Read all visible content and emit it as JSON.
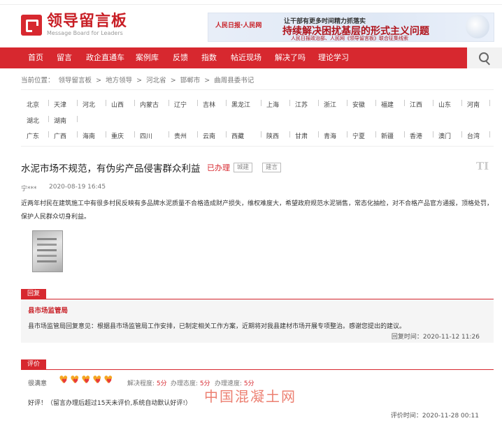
{
  "logo": {
    "title": "领导留言板",
    "subtitle": "Message Board for Leaders"
  },
  "banner": {
    "brand": "人民日报·人民网",
    "line1": "让干部有更多时间精力抓落实",
    "line2": "持续解决困扰基层的形式主义问题",
    "line3": "人民日报政治部、人民网《领导留言板》联合征集线索"
  },
  "nav": {
    "items": [
      "首页",
      "留言",
      "政企直通车",
      "案例库",
      "反馈",
      "指数",
      "帖近现场",
      "解决了吗",
      "理论学习"
    ]
  },
  "breadcrumb": {
    "items": [
      "当前位置：",
      "领导留言板",
      ">",
      "地方领导",
      ">",
      "河北省",
      ">",
      "邯郸市",
      ">",
      "曲周县委书记"
    ]
  },
  "regions": {
    "row1": [
      "北京",
      "天津",
      "河北",
      "山西",
      "内蒙古",
      "辽宁",
      "吉林",
      "黑龙江",
      "上海",
      "江苏",
      "浙江",
      "安徽",
      "福建",
      "江西",
      "山东",
      "河南"
    ],
    "row2": [
      "湖北",
      "湖南"
    ],
    "row3": [
      "广东",
      "广西",
      "海南",
      "重庆",
      "四川",
      "贵州",
      "云南",
      "西藏",
      "陕西",
      "甘肃",
      "青海",
      "宁夏",
      "新疆",
      "香港",
      "澳门",
      "台湾"
    ]
  },
  "message": {
    "title": "水泥市场不规范，有伪劣产品侵害群众利益",
    "status": "已办理",
    "tags": [
      "城建",
      "建言"
    ],
    "author": "宁***",
    "time": "2020-08-19 16:45",
    "content": "近两年村民在建筑施工中有很多村民反映有多品牌水泥质量不合格造成财产损失，维权难度大，希望政府规范水泥销售，常态化抽检，对不合格产品官方通报，顶格处罚，保护人民群众切身利益。"
  },
  "reply": {
    "label": "回复",
    "org": "县市场监管局",
    "text": "县市场监管局回复意见：根据县市场监管局工作安排，已制定相关工作方案，近期将对我县建材市场开展专项整治。感谢您提出的建议。",
    "time": "回复时间：2020-11-12 11:26"
  },
  "evaluation": {
    "label": "评价",
    "overall_label": "很满意",
    "rating": 5,
    "metrics": [
      {
        "label": "解决程度:",
        "value": "5分"
      },
      {
        "label": "办理态度:",
        "value": "5分"
      },
      {
        "label": "办理速度:",
        "value": "5分"
      }
    ],
    "comment": "好评！（留言办理后超过15天未评价,系统自动默认好评!）",
    "time": "评价时间：2020-11-28 00:11"
  },
  "watermark": "中国混凝土网",
  "colors": {
    "brand_red": "#d7282f",
    "heart_orange": "#f5a623"
  }
}
